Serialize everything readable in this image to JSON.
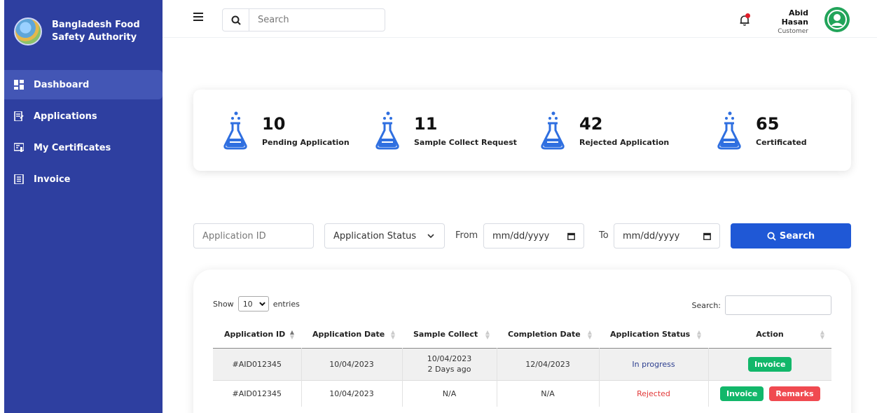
{
  "brand": {
    "name_line1": "Bangladesh Food",
    "name_line2": "Safety Authority"
  },
  "sidebar": {
    "items": [
      {
        "label": "Dashboard",
        "icon": "dashboard-icon",
        "active": true
      },
      {
        "label": "Applications",
        "icon": "applications-icon"
      },
      {
        "label": "My Certificates",
        "icon": "certificate-icon"
      },
      {
        "label": "Invoice",
        "icon": "invoice-icon"
      }
    ]
  },
  "topbar": {
    "search_placeholder": "Search",
    "user_name": "Abid Hasan",
    "user_role": "Customer"
  },
  "stats": [
    {
      "value": "10",
      "label": "Pending Application"
    },
    {
      "value": "11",
      "label": "Sample Collect Request"
    },
    {
      "value": "42",
      "label": "Rejected Application"
    },
    {
      "value": "65",
      "label": "Certificated"
    }
  ],
  "filters": {
    "app_id_placeholder": "Application ID",
    "status_label": "Application Status",
    "from_label": "From",
    "to_label": "To",
    "date_placeholder": "mm/dd/yyyy",
    "search_button": "Search"
  },
  "table": {
    "show_label": "Show",
    "entries_value": "10",
    "entries_label": "entries",
    "search_label": "Search:",
    "columns": [
      "Application ID",
      "Application Date",
      "Sample Collect",
      "Completion Date",
      "Application Status",
      "Action"
    ],
    "rows": [
      {
        "id": "#AID012345",
        "date": "10/04/2023",
        "sample": "10/04/2023",
        "sample_sub": "2 Days ago",
        "completion": "12/04/2023",
        "status": "In progress",
        "actions": [
          "Invoice"
        ]
      },
      {
        "id": "#AID012345",
        "date": "10/04/2023",
        "sample": "N/A",
        "sample_sub": "",
        "completion": "N/A",
        "status": "Rejected",
        "actions": [
          "Invoice",
          "Remarks"
        ]
      }
    ]
  },
  "colors": {
    "sidebar": "#2e3fa0",
    "primary": "#1f58d6",
    "success": "#12b76a",
    "danger": "#f04a50",
    "flask": "#2f6fe0"
  }
}
